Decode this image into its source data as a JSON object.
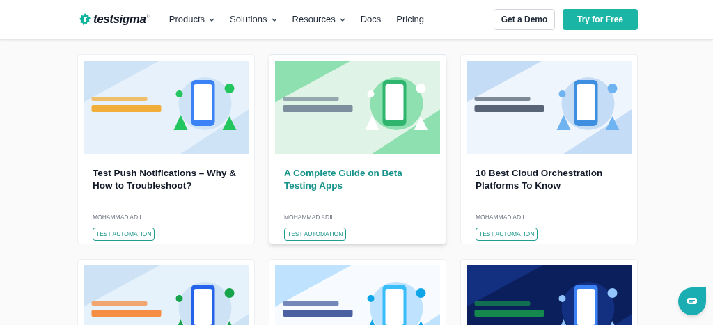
{
  "header": {
    "logo": {
      "text": "testsigma",
      "mark": "®"
    },
    "nav": [
      {
        "label": "Products",
        "dropdown": true
      },
      {
        "label": "Solutions",
        "dropdown": true
      },
      {
        "label": "Resources",
        "dropdown": true
      },
      {
        "label": "Docs",
        "dropdown": false
      },
      {
        "label": "Pricing",
        "dropdown": false
      }
    ],
    "demo_button": "Get a Demo",
    "trial_button": "Try for Free"
  },
  "cards": [
    {
      "title": "Test Push Notifications – Why & How to Troubleshoot?",
      "author": "MOHAMMAD ADIL",
      "tag": "TEST AUTOMATION",
      "highlighted": false
    },
    {
      "title": "A Complete Guide on Beta Testing Apps",
      "author": "MOHAMMAD ADIL",
      "tag": "TEST AUTOMATION",
      "highlighted": true
    },
    {
      "title": "10 Best Cloud Orchestration Platforms To Know",
      "author": "MOHAMMAD ADIL",
      "tag": "TEST AUTOMATION",
      "highlighted": false
    },
    {
      "kind": "picture"
    },
    {
      "kind": "picture"
    },
    {
      "kind": "picture"
    }
  ]
}
